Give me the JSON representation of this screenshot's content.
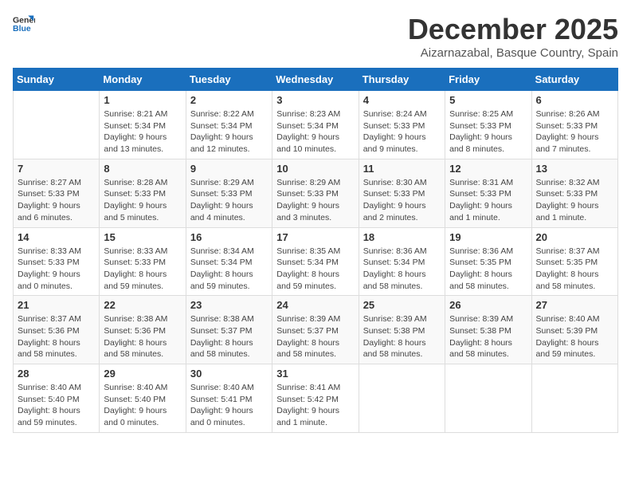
{
  "logo": {
    "text_general": "General",
    "text_blue": "Blue"
  },
  "title": "December 2025",
  "subtitle": "Aizarnazabal, Basque Country, Spain",
  "days_of_week": [
    "Sunday",
    "Monday",
    "Tuesday",
    "Wednesday",
    "Thursday",
    "Friday",
    "Saturday"
  ],
  "weeks": [
    [
      {
        "day": "",
        "info": ""
      },
      {
        "day": "1",
        "info": "Sunrise: 8:21 AM\nSunset: 5:34 PM\nDaylight: 9 hours\nand 13 minutes."
      },
      {
        "day": "2",
        "info": "Sunrise: 8:22 AM\nSunset: 5:34 PM\nDaylight: 9 hours\nand 12 minutes."
      },
      {
        "day": "3",
        "info": "Sunrise: 8:23 AM\nSunset: 5:34 PM\nDaylight: 9 hours\nand 10 minutes."
      },
      {
        "day": "4",
        "info": "Sunrise: 8:24 AM\nSunset: 5:33 PM\nDaylight: 9 hours\nand 9 minutes."
      },
      {
        "day": "5",
        "info": "Sunrise: 8:25 AM\nSunset: 5:33 PM\nDaylight: 9 hours\nand 8 minutes."
      },
      {
        "day": "6",
        "info": "Sunrise: 8:26 AM\nSunset: 5:33 PM\nDaylight: 9 hours\nand 7 minutes."
      }
    ],
    [
      {
        "day": "7",
        "info": "Sunrise: 8:27 AM\nSunset: 5:33 PM\nDaylight: 9 hours\nand 6 minutes."
      },
      {
        "day": "8",
        "info": "Sunrise: 8:28 AM\nSunset: 5:33 PM\nDaylight: 9 hours\nand 5 minutes."
      },
      {
        "day": "9",
        "info": "Sunrise: 8:29 AM\nSunset: 5:33 PM\nDaylight: 9 hours\nand 4 minutes."
      },
      {
        "day": "10",
        "info": "Sunrise: 8:29 AM\nSunset: 5:33 PM\nDaylight: 9 hours\nand 3 minutes."
      },
      {
        "day": "11",
        "info": "Sunrise: 8:30 AM\nSunset: 5:33 PM\nDaylight: 9 hours\nand 2 minutes."
      },
      {
        "day": "12",
        "info": "Sunrise: 8:31 AM\nSunset: 5:33 PM\nDaylight: 9 hours\nand 1 minute."
      },
      {
        "day": "13",
        "info": "Sunrise: 8:32 AM\nSunset: 5:33 PM\nDaylight: 9 hours\nand 1 minute."
      }
    ],
    [
      {
        "day": "14",
        "info": "Sunrise: 8:33 AM\nSunset: 5:33 PM\nDaylight: 9 hours\nand 0 minutes."
      },
      {
        "day": "15",
        "info": "Sunrise: 8:33 AM\nSunset: 5:33 PM\nDaylight: 8 hours\nand 59 minutes."
      },
      {
        "day": "16",
        "info": "Sunrise: 8:34 AM\nSunset: 5:34 PM\nDaylight: 8 hours\nand 59 minutes."
      },
      {
        "day": "17",
        "info": "Sunrise: 8:35 AM\nSunset: 5:34 PM\nDaylight: 8 hours\nand 59 minutes."
      },
      {
        "day": "18",
        "info": "Sunrise: 8:36 AM\nSunset: 5:34 PM\nDaylight: 8 hours\nand 58 minutes."
      },
      {
        "day": "19",
        "info": "Sunrise: 8:36 AM\nSunset: 5:35 PM\nDaylight: 8 hours\nand 58 minutes."
      },
      {
        "day": "20",
        "info": "Sunrise: 8:37 AM\nSunset: 5:35 PM\nDaylight: 8 hours\nand 58 minutes."
      }
    ],
    [
      {
        "day": "21",
        "info": "Sunrise: 8:37 AM\nSunset: 5:36 PM\nDaylight: 8 hours\nand 58 minutes."
      },
      {
        "day": "22",
        "info": "Sunrise: 8:38 AM\nSunset: 5:36 PM\nDaylight: 8 hours\nand 58 minutes."
      },
      {
        "day": "23",
        "info": "Sunrise: 8:38 AM\nSunset: 5:37 PM\nDaylight: 8 hours\nand 58 minutes."
      },
      {
        "day": "24",
        "info": "Sunrise: 8:39 AM\nSunset: 5:37 PM\nDaylight: 8 hours\nand 58 minutes."
      },
      {
        "day": "25",
        "info": "Sunrise: 8:39 AM\nSunset: 5:38 PM\nDaylight: 8 hours\nand 58 minutes."
      },
      {
        "day": "26",
        "info": "Sunrise: 8:39 AM\nSunset: 5:38 PM\nDaylight: 8 hours\nand 58 minutes."
      },
      {
        "day": "27",
        "info": "Sunrise: 8:40 AM\nSunset: 5:39 PM\nDaylight: 8 hours\nand 59 minutes."
      }
    ],
    [
      {
        "day": "28",
        "info": "Sunrise: 8:40 AM\nSunset: 5:40 PM\nDaylight: 8 hours\nand 59 minutes."
      },
      {
        "day": "29",
        "info": "Sunrise: 8:40 AM\nSunset: 5:40 PM\nDaylight: 9 hours\nand 0 minutes."
      },
      {
        "day": "30",
        "info": "Sunrise: 8:40 AM\nSunset: 5:41 PM\nDaylight: 9 hours\nand 0 minutes."
      },
      {
        "day": "31",
        "info": "Sunrise: 8:41 AM\nSunset: 5:42 PM\nDaylight: 9 hours\nand 1 minute."
      },
      {
        "day": "",
        "info": ""
      },
      {
        "day": "",
        "info": ""
      },
      {
        "day": "",
        "info": ""
      }
    ]
  ]
}
